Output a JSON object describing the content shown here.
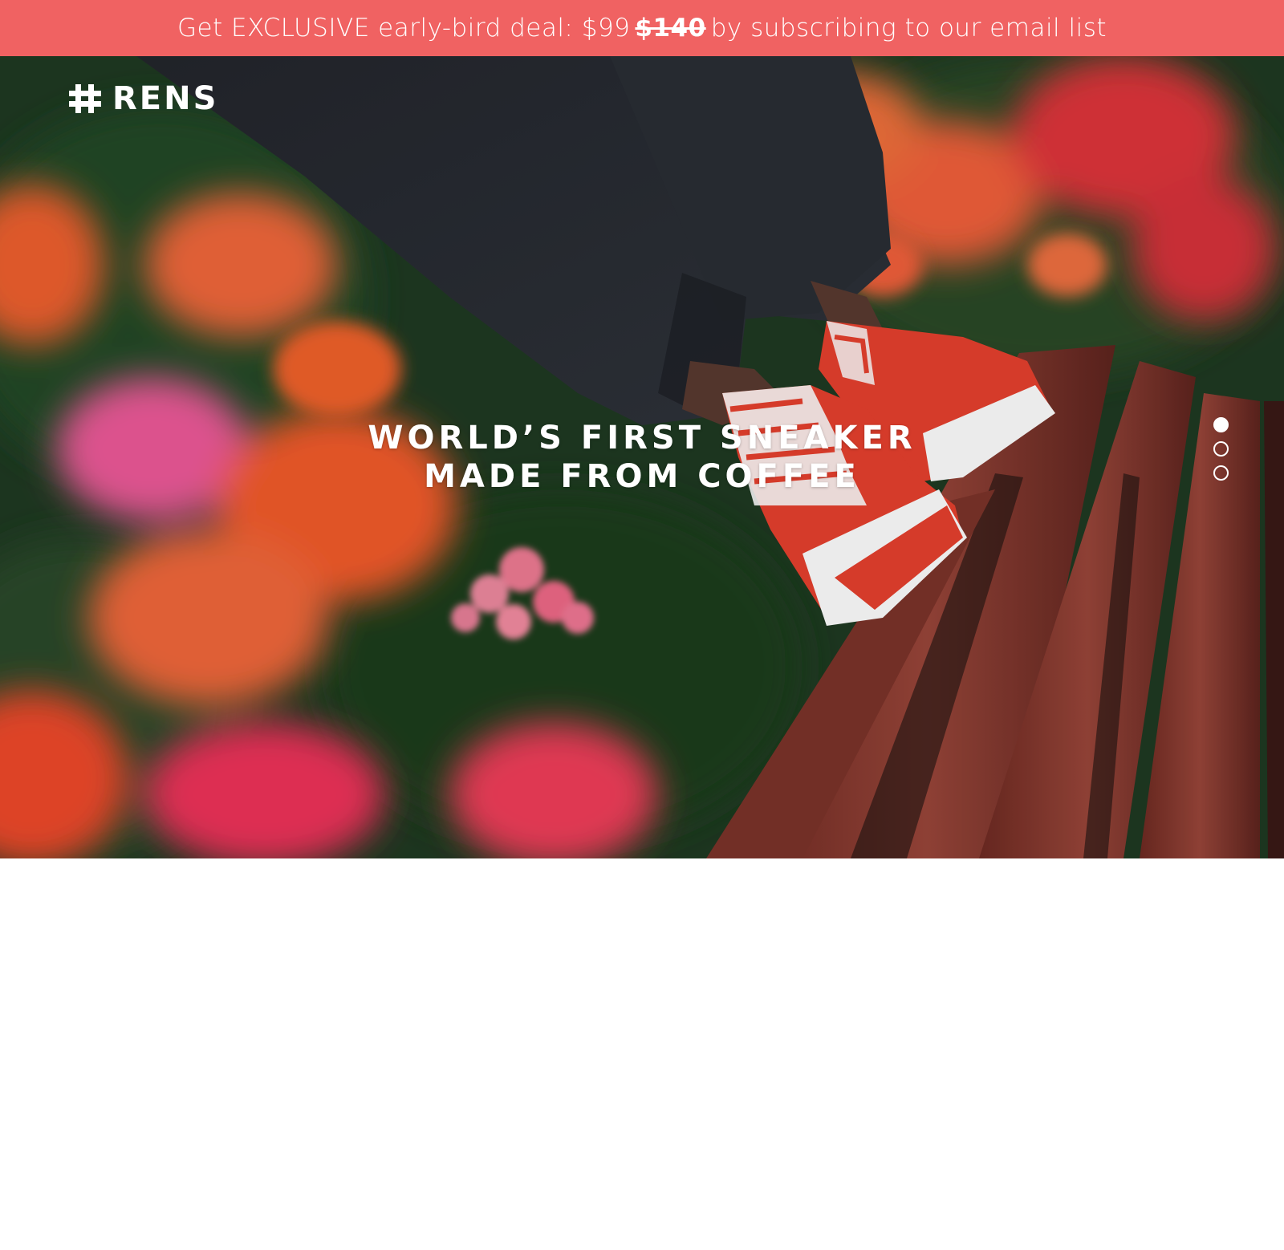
{
  "promo": {
    "prefix": "Get EXCLUSIVE early-bird deal: $99",
    "old_price": "$140",
    "suffix": "by subscribing to our email list"
  },
  "brand": {
    "logo_icon": "hash-icon",
    "name": "RENS"
  },
  "hero": {
    "headline_line1": "WORLD’S FIRST SNEAKER",
    "headline_line2": "MADE FROM COFFEE",
    "slides": [
      {
        "label": "slide 1",
        "active": true
      },
      {
        "label": "slide 2",
        "active": false
      },
      {
        "label": "slide 3",
        "active": false
      }
    ]
  },
  "colors": {
    "promo_background": "#f06262",
    "text": "#ffffff",
    "sneaker_red": "#e8402e",
    "bench_wood": "#8a3a30"
  }
}
